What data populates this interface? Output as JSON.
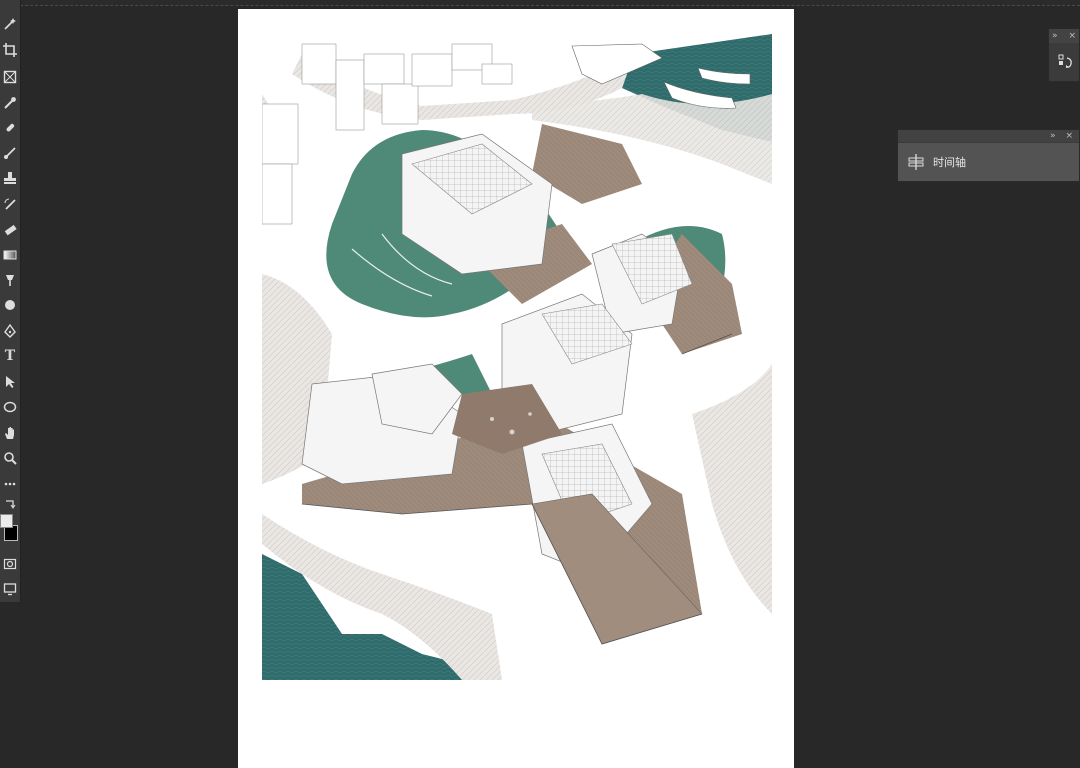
{
  "app": {
    "toolbar": {
      "tools": [
        {
          "icon": "magic-wand-icon"
        },
        {
          "icon": "crop-icon"
        },
        {
          "icon": "frame-icon"
        },
        {
          "icon": "eyedropper-icon"
        },
        {
          "icon": "healing-brush-icon"
        },
        {
          "icon": "brush-icon"
        },
        {
          "icon": "clone-stamp-icon"
        },
        {
          "icon": "history-brush-icon"
        },
        {
          "icon": "eraser-icon"
        },
        {
          "icon": "gradient-icon"
        },
        {
          "icon": "blur-icon"
        },
        {
          "icon": "dodge-icon"
        },
        {
          "icon": "pen-icon"
        },
        {
          "icon": "type-icon",
          "glyph": "T"
        },
        {
          "icon": "path-selection-icon"
        },
        {
          "icon": "ellipse-shape-icon"
        },
        {
          "icon": "hand-icon"
        },
        {
          "icon": "zoom-icon"
        },
        {
          "icon": "more-tools-icon"
        },
        {
          "icon": "swap-colors-icon"
        }
      ],
      "foreground_color": "#ececec",
      "background_color": "#000000"
    },
    "panels": {
      "mini": {
        "collapse_glyph": "»",
        "close_glyph": "×"
      },
      "timeline": {
        "collapse_glyph": "»",
        "close_glyph": "×",
        "label": "时间轴"
      }
    },
    "document": {
      "colors": {
        "water": "#2f6b6b",
        "green": "#4f8a79",
        "deck": "#a08d7e",
        "paper": "#ffffff",
        "workspace": "#282828"
      }
    }
  }
}
